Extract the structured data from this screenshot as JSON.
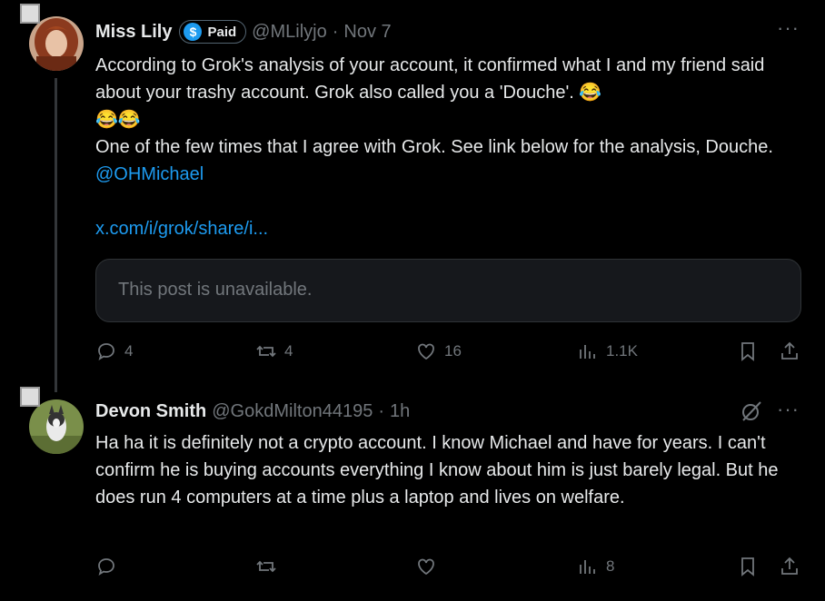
{
  "post1": {
    "name": "Miss Lily",
    "badge_label": "Paid",
    "badge_icon": "$",
    "handle": "@MLilyjo",
    "separator": "·",
    "date": "Nov 7",
    "text_line1": "According to Grok's analysis of your account, it confirmed what I and my friend said about your trashy account.  Grok also called you a 'Douche'.",
    "emoji": "😂",
    "text_line2": "One of the few times that I agree with Grok.  See link below for the analysis, Douche.",
    "mention": "@OHMichael",
    "link": "x.com/i/grok/share/i...",
    "quote_text": "This post is unavailable.",
    "stats": {
      "replies": "4",
      "reposts": "4",
      "likes": "16",
      "views": "1.1K"
    }
  },
  "post2": {
    "name": "Devon Smith",
    "handle": "@GokdMilton44195",
    "separator": "·",
    "time": "1h",
    "text": "Ha ha it is definitely not a crypto account. I know Michael and have for years. I can't confirm he is buying accounts everything I know about him is just barely legal. But he does run 4 computers at a time plus a laptop and lives on welfare.",
    "stats": {
      "views": "8"
    }
  },
  "colors": {
    "accent": "#1d9bf0",
    "muted": "#71767b",
    "text": "#e7e9ea",
    "background": "#000000"
  }
}
